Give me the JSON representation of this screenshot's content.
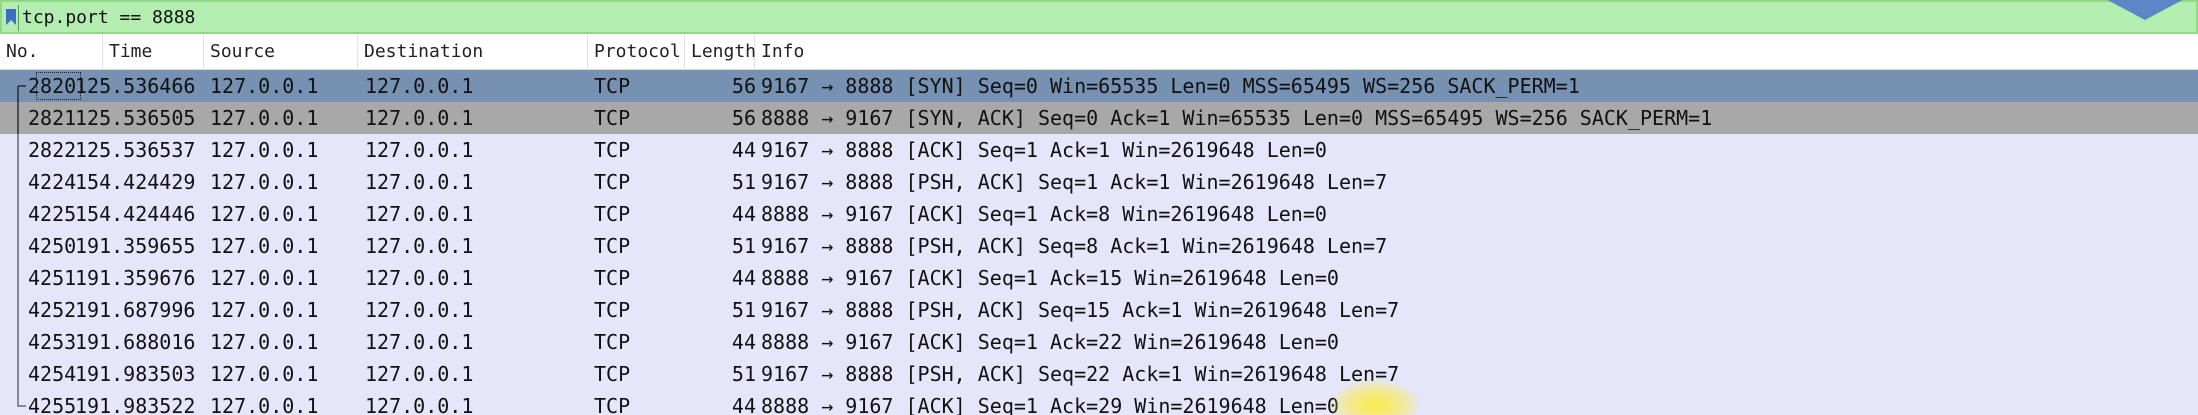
{
  "filter": {
    "value": "tcp.port == 8888",
    "icon": "bookmark-icon"
  },
  "columns": [
    "No.",
    "Time",
    "Source",
    "Destination",
    "Protocol",
    "Length",
    "Info"
  ],
  "packets": [
    {
      "no": "2820",
      "time": "125.536466",
      "source": "127.0.0.1",
      "destination": "127.0.0.1",
      "protocol": "TCP",
      "length": "56",
      "info": "9167 → 8888 [SYN] Seq=0 Win=65535 Len=0 MSS=65495 WS=256 SACK_PERM=1",
      "state": "selected"
    },
    {
      "no": "2821",
      "time": "125.536505",
      "source": "127.0.0.1",
      "destination": "127.0.0.1",
      "protocol": "TCP",
      "length": "56",
      "info": "8888 → 9167 [SYN, ACK] Seq=0 Ack=1 Win=65535 Len=0 MSS=65495 WS=256 SACK_PERM=1",
      "state": "related"
    },
    {
      "no": "2822",
      "time": "125.536537",
      "source": "127.0.0.1",
      "destination": "127.0.0.1",
      "protocol": "TCP",
      "length": "44",
      "info": "9167 → 8888 [ACK] Seq=1 Ack=1 Win=2619648 Len=0",
      "state": "normal"
    },
    {
      "no": "4224",
      "time": "154.424429",
      "source": "127.0.0.1",
      "destination": "127.0.0.1",
      "protocol": "TCP",
      "length": "51",
      "info": "9167 → 8888 [PSH, ACK] Seq=1 Ack=1 Win=2619648 Len=7",
      "state": "normal"
    },
    {
      "no": "4225",
      "time": "154.424446",
      "source": "127.0.0.1",
      "destination": "127.0.0.1",
      "protocol": "TCP",
      "length": "44",
      "info": "8888 → 9167 [ACK] Seq=1 Ack=8 Win=2619648 Len=0",
      "state": "normal"
    },
    {
      "no": "4250",
      "time": "191.359655",
      "source": "127.0.0.1",
      "destination": "127.0.0.1",
      "protocol": "TCP",
      "length": "51",
      "info": "9167 → 8888 [PSH, ACK] Seq=8 Ack=1 Win=2619648 Len=7",
      "state": "normal"
    },
    {
      "no": "4251",
      "time": "191.359676",
      "source": "127.0.0.1",
      "destination": "127.0.0.1",
      "protocol": "TCP",
      "length": "44",
      "info": "8888 → 9167 [ACK] Seq=1 Ack=15 Win=2619648 Len=0",
      "state": "normal"
    },
    {
      "no": "4252",
      "time": "191.687996",
      "source": "127.0.0.1",
      "destination": "127.0.0.1",
      "protocol": "TCP",
      "length": "51",
      "info": "9167 → 8888 [PSH, ACK] Seq=15 Ack=1 Win=2619648 Len=7",
      "state": "normal"
    },
    {
      "no": "4253",
      "time": "191.688016",
      "source": "127.0.0.1",
      "destination": "127.0.0.1",
      "protocol": "TCP",
      "length": "44",
      "info": "8888 → 9167 [ACK] Seq=1 Ack=22 Win=2619648 Len=0",
      "state": "normal"
    },
    {
      "no": "4254",
      "time": "191.983503",
      "source": "127.0.0.1",
      "destination": "127.0.0.1",
      "protocol": "TCP",
      "length": "51",
      "info": "9167 → 8888 [PSH, ACK] Seq=22 Ack=1 Win=2619648 Len=7",
      "state": "normal"
    },
    {
      "no": "4255",
      "time": "191.983522",
      "source": "127.0.0.1",
      "destination": "127.0.0.1",
      "protocol": "TCP",
      "length": "44",
      "info": "8888 → 9167 [ACK] Seq=1 Ack=29 Win=2619648 Len=0",
      "state": "normal"
    }
  ],
  "colors": {
    "filter_bg": "#b3eeb0",
    "row_bg": "#e6e6fa",
    "selected_bg": "#7791b3",
    "related_bg": "#a8a8a8",
    "arrow": "#5b87c7"
  }
}
